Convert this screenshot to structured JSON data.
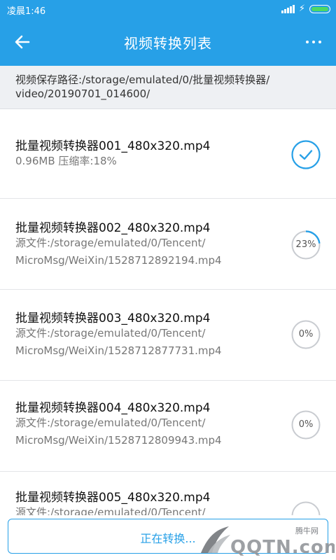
{
  "status": {
    "time": "凌晨1:46"
  },
  "appbar": {
    "title": "视频转换列表"
  },
  "path": {
    "line1": "视频保存路径:/storage/emulated/0/批量视频转换器/",
    "line2": "video/20190701_014600/"
  },
  "items": [
    {
      "name": "批量视频转换器001_480x320.mp4",
      "sub1": "0.96MB 压缩率:18%",
      "sub2": "",
      "state": "done",
      "progress": 1.0,
      "label": ""
    },
    {
      "name": "批量视频转换器002_480x320.mp4",
      "sub1": "源文件:/storage/emulated/0/Tencent/",
      "sub2": "MicroMsg/WeiXin/1528712892194.mp4",
      "state": "progress",
      "progress": 0.23,
      "label": "23%"
    },
    {
      "name": "批量视频转换器003_480x320.mp4",
      "sub1": "源文件:/storage/emulated/0/Tencent/",
      "sub2": "MicroMsg/WeiXin/1528712877731.mp4",
      "state": "waiting",
      "progress": 0,
      "label": "0%"
    },
    {
      "name": "批量视频转换器004_480x320.mp4",
      "sub1": "源文件:/storage/emulated/0/Tencent/",
      "sub2": "MicroMsg/WeiXin/1528712809943.mp4",
      "state": "waiting",
      "progress": 0,
      "label": "0%"
    },
    {
      "name": "批量视频转换器005_480x320.mp4",
      "sub1": "源文件:/storage/emulated/0/Tencent/",
      "sub2": "",
      "state": "waiting",
      "progress": 0,
      "label": ""
    }
  ],
  "bottom": {
    "label": "正在转换..."
  },
  "watermark": {
    "site": "腾牛网",
    "logo": "QQTN.com"
  },
  "colors": {
    "accent": "#27a0e7",
    "ring_track": "#c9ccd1"
  },
  "icons": {
    "back": "arrow-left-icon",
    "more": "more-dots-icon",
    "done": "check-circle-icon"
  }
}
